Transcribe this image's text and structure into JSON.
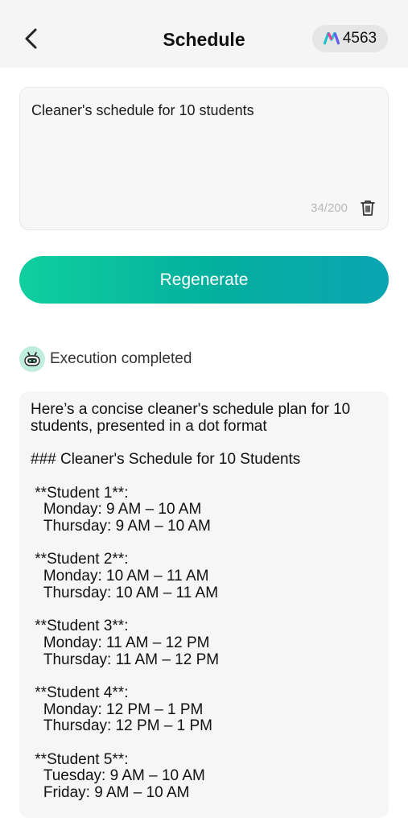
{
  "header": {
    "back_icon": "chevron-left-icon",
    "title": "Schedule",
    "credits_icon": "brand-logo-icon",
    "credits": "4563"
  },
  "prompt": {
    "text": "Cleaner's schedule for 10 students",
    "char_count": "34/200",
    "delete_icon": "trash-icon"
  },
  "actions": {
    "regenerate_label": "Regenerate"
  },
  "status": {
    "avatar_icon": "robot-icon",
    "text": "Execution completed"
  },
  "result": {
    "text": "Here’s a concise cleaner's schedule plan for 10 students, presented in a dot format\n\n### Cleaner's Schedule for 10 Students\n\n **Student 1**:\n   Monday: 9 AM – 10 AM\n   Thursday: 9 AM – 10 AM\n\n **Student 2**:\n   Monday: 10 AM – 11 AM\n   Thursday: 10 AM – 11 AM\n\n **Student 3**:\n   Monday: 11 AM – 12 PM\n   Thursday: 11 AM – 12 PM\n\n **Student 4**:\n   Monday: 12 PM – 1 PM\n   Thursday: 12 PM – 1 PM\n\n **Student 5**:\n   Tuesday: 9 AM – 10 AM\n   Friday: 9 AM – 10 AM"
  },
  "colors": {
    "accent_start": "#10cf9e",
    "accent_end": "#0aa5b2",
    "topbar_bg": "#f5f5f5",
    "card_bg": "#f6f6f6"
  }
}
